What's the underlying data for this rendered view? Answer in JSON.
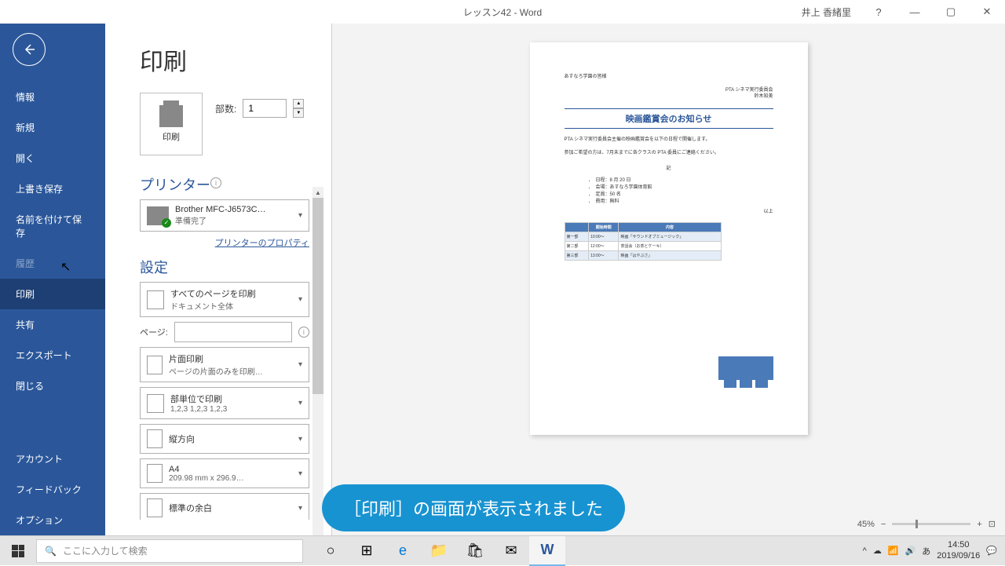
{
  "titlebar": {
    "doc_title": "レッスン42  -  Word",
    "user": "井上 香緒里",
    "help": "?",
    "min": "—",
    "max": "▢",
    "close": "✕"
  },
  "sidebar": {
    "back": "←",
    "items": [
      {
        "label": "情報"
      },
      {
        "label": "新規"
      },
      {
        "label": "開く"
      },
      {
        "label": "上書き保存"
      },
      {
        "label": "名前を付けて保存"
      },
      {
        "label": "履歴",
        "disabled": true
      },
      {
        "label": "印刷",
        "active": true
      },
      {
        "label": "共有"
      },
      {
        "label": "エクスポート"
      },
      {
        "label": "閉じる"
      }
    ],
    "bottom": [
      {
        "label": "アカウント"
      },
      {
        "label": "フィードバック"
      },
      {
        "label": "オプション"
      }
    ]
  },
  "print": {
    "title": "印刷",
    "print_btn": "印刷",
    "copies_label": "部数:",
    "copies_value": "1",
    "printer_section": "プリンター",
    "printer_name": "Brother MFC-J6573C…",
    "printer_status": "準備完了",
    "printer_props": "プリンターのプロパティ",
    "settings_section": "設定",
    "setting_pages_title": "すべてのページを印刷",
    "setting_pages_sub": "ドキュメント全体",
    "page_label": "ページ:",
    "setting_side_title": "片面印刷",
    "setting_side_sub": "ページの片面のみを印刷…",
    "setting_collate_title": "部単位で印刷",
    "setting_collate_sub": "1,2,3   1,2,3   1,2,3",
    "setting_orient_title": "縦方向",
    "setting_paper_title": "A4",
    "setting_paper_sub": "209.98 mm x 296.9…",
    "setting_margin_title": "標準の余白"
  },
  "preview": {
    "zoom": "45%",
    "doc": {
      "to": "あすなろ学園の皆様",
      "from1": "PTA シネマ実行委員会",
      "from2": "鈴木知美",
      "title": "映画鑑賞会のお知らせ",
      "body1": "PTA シネマ実行委員会主催の映画鑑賞会を以下の日程で開催します。",
      "body2": "参加ご希望の方は、7月末までに各クラスの PTA 委員にご連絡ください。",
      "rec": "記",
      "bullets": [
        "日程：8 月 20 日",
        "会場：あすなろ学園体育館",
        "定員：50 名",
        "費用：無料"
      ],
      "end": "以上",
      "table_headers": [
        "",
        "開始時間",
        "内容"
      ],
      "table_rows": [
        [
          "第一部",
          "10:00～",
          "映画「サウンドオブミュージック」"
        ],
        [
          "第二部",
          "12:00～",
          "茶話会（お茶とケーキ）"
        ],
        [
          "第三部",
          "13:00～",
          "映画「はやぶさ」"
        ]
      ]
    }
  },
  "callout": "［印刷］の画面が表示されました",
  "taskbar": {
    "search_placeholder": "ここに入力して検索",
    "time": "14:50",
    "date": "2019/09/16"
  }
}
